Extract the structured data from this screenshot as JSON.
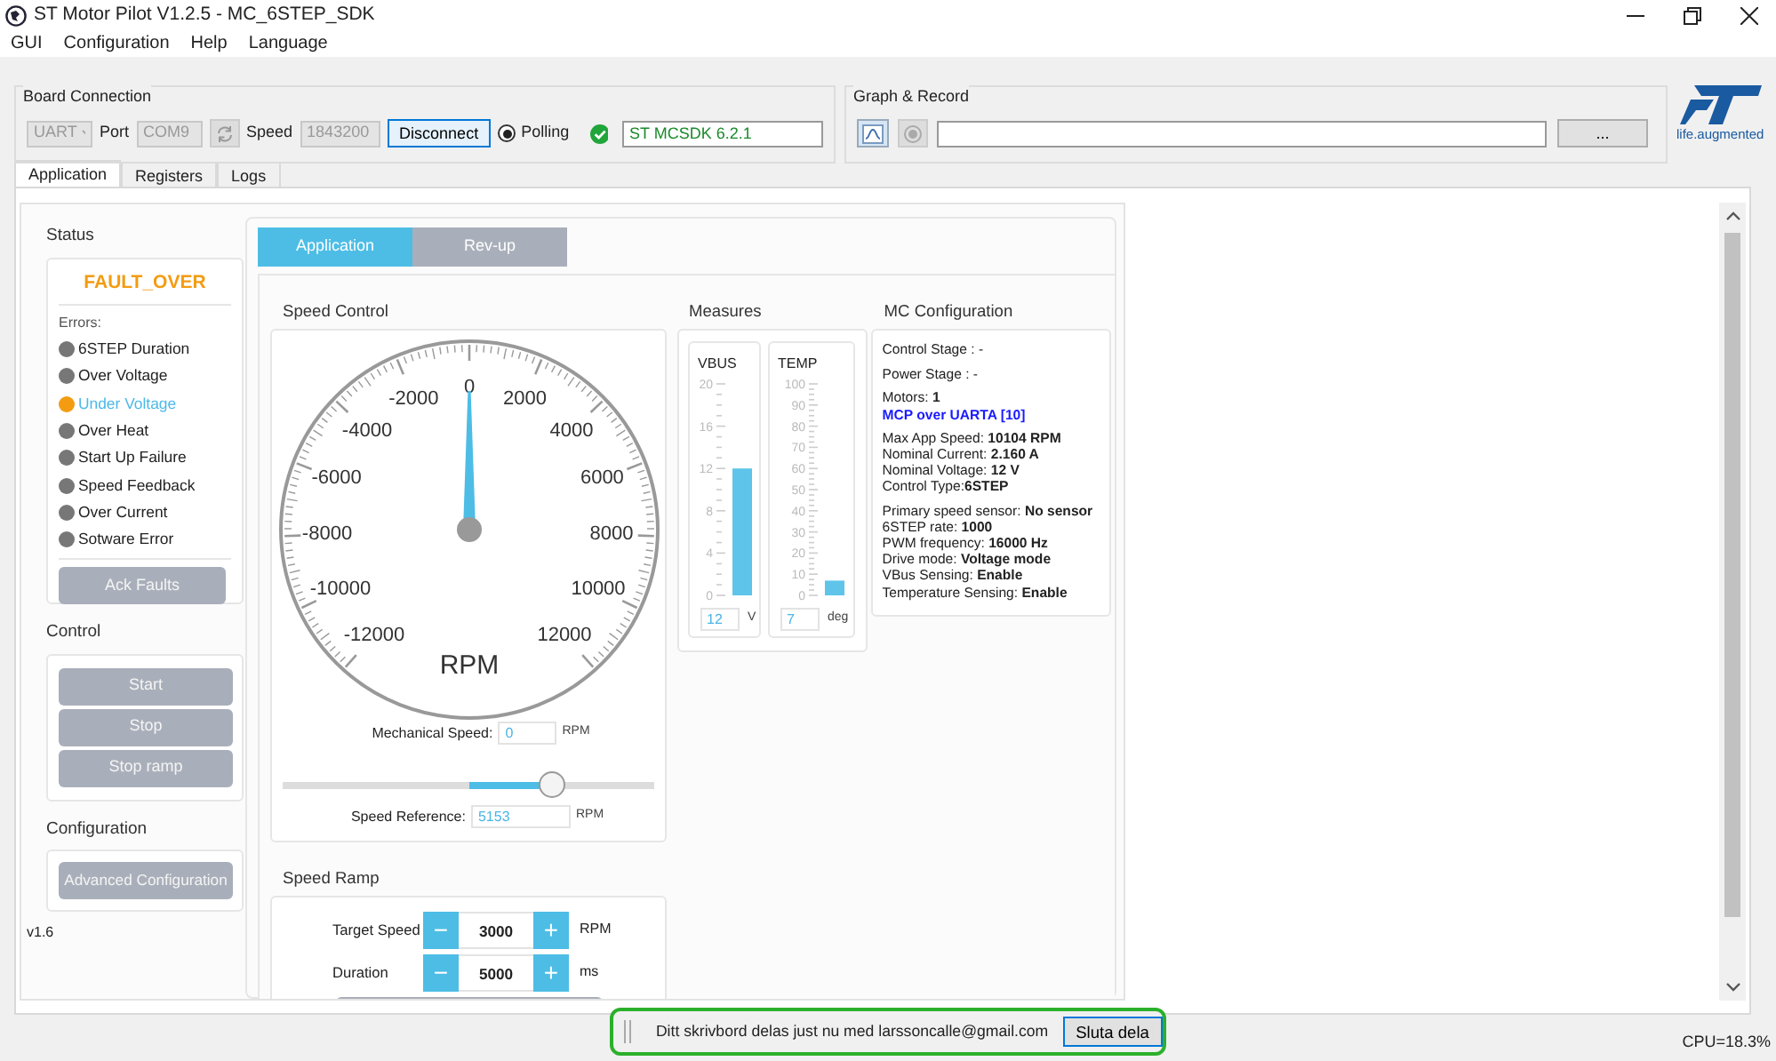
{
  "window": {
    "title": "ST Motor Pilot V1.2.5 - MC_6STEP_SDK"
  },
  "menu": [
    "GUI",
    "Configuration",
    "Help",
    "Language"
  ],
  "board_connection": {
    "title": "Board Connection",
    "interface": "UART",
    "port_label": "Port",
    "port": "COM9",
    "speed_label": "Speed",
    "speed": "1843200",
    "connect_button": "Disconnect",
    "polling": {
      "label": "Polling",
      "selected": true
    },
    "firmware": "ST MCSDK 6.2.1"
  },
  "graph_record": {
    "title": "Graph & Record",
    "browse_button": "..."
  },
  "logo": {
    "tagline": "life.augmented"
  },
  "tabs": [
    {
      "label": "Application",
      "selected": true
    },
    {
      "label": "Registers",
      "selected": false
    },
    {
      "label": "Logs",
      "selected": false
    }
  ],
  "status": {
    "title": "Status",
    "state": "FAULT_OVER",
    "errors_label": "Errors:",
    "errors": [
      {
        "label": "6STEP Duration",
        "active": false
      },
      {
        "label": "Over Voltage",
        "active": false
      },
      {
        "label": "Under Voltage",
        "active": true
      },
      {
        "label": "Over Heat",
        "active": false
      },
      {
        "label": "Start Up Failure",
        "active": false
      },
      {
        "label": "Speed Feedback",
        "active": false
      },
      {
        "label": "Over Current",
        "active": false
      },
      {
        "label": "Sotware Error",
        "active": false
      }
    ],
    "ack_button": "Ack Faults"
  },
  "control": {
    "title": "Control",
    "buttons": [
      "Start",
      "Stop",
      "Stop ramp"
    ]
  },
  "configuration": {
    "title": "Configuration",
    "button": "Advanced Configuration"
  },
  "version": "v1.6",
  "subtabs": [
    {
      "label": "Application",
      "selected": true
    },
    {
      "label": "Rev-up",
      "selected": false
    }
  ],
  "speed_control": {
    "title": "Speed Control",
    "gauge": {
      "tick_labels": [
        "0",
        "-2000",
        "2000",
        "-4000",
        "4000",
        "-6000",
        "6000",
        "-8000",
        "8000",
        "-10000",
        "10000",
        "-12000",
        "12000"
      ],
      "unit": "RPM",
      "level": 0.5
    },
    "mechanical_speed": {
      "label": "Mechanical Speed:",
      "value": "0",
      "unit": "RPM"
    },
    "slider": {
      "level": 0.74
    },
    "speed_reference": {
      "label": "Speed Reference:",
      "value": "5153",
      "unit": "RPM"
    }
  },
  "speed_ramp": {
    "title": "Speed Ramp",
    "rows": [
      {
        "label": "Target Speed",
        "minus": "−",
        "value": "3000",
        "plus": "+",
        "unit": "RPM"
      },
      {
        "label": "Duration",
        "minus": "−",
        "value": "5000",
        "plus": "+",
        "unit": "ms"
      }
    ]
  },
  "measures": {
    "title": "Measures",
    "meters": [
      {
        "name": "VBUS",
        "scale": [
          "20",
          "16",
          "12",
          "8",
          "4",
          "0"
        ],
        "level": 0.6,
        "value": "12",
        "unit": "V"
      },
      {
        "name": "TEMP",
        "scale": [
          "100",
          "90",
          "80",
          "70",
          "60",
          "50",
          "40",
          "30",
          "20",
          "10",
          "0"
        ],
        "level": 0.07,
        "value": "7",
        "unit": "deg"
      }
    ]
  },
  "mc_configuration": {
    "title": "MC Configuration",
    "groups": [
      [
        {
          "kind": "line",
          "text": "Control Stage : -"
        }
      ],
      [
        {
          "kind": "line",
          "text": "Power Stage : -"
        }
      ],
      [
        {
          "kind": "line",
          "text": "Motors: **1**"
        },
        {
          "kind": "value",
          "text": "MCP over UARTA [10]"
        }
      ],
      [
        {
          "kind": "line",
          "text": "Max App Speed: **10104 RPM**"
        },
        {
          "kind": "line",
          "text": "Nominal Current: **2.160 A**"
        },
        {
          "kind": "line",
          "text": "Nominal Voltage: **12 V**"
        },
        {
          "kind": "line",
          "text": "Control Type:**6STEP**"
        }
      ],
      [
        {
          "kind": "line",
          "text": "Primary speed sensor: **No sensor**"
        },
        {
          "kind": "line",
          "text": "6STEP rate: **1000**"
        },
        {
          "kind": "line",
          "text": "PWM frequency: **16000 Hz**"
        },
        {
          "kind": "line",
          "text": "Drive mode: **Voltage mode**"
        },
        {
          "kind": "line",
          "text": "VBus Sensing: **Enable**"
        },
        {
          "kind": "line",
          "text": "Temperature Sensing: **Enable**"
        }
      ]
    ]
  },
  "sharing": {
    "message": "Ditt skrivbord delas just nu med larssoncalle@gmail.com",
    "button": "Sluta dela"
  },
  "status_bar": {
    "cpu": "CPU=18.3%"
  }
}
